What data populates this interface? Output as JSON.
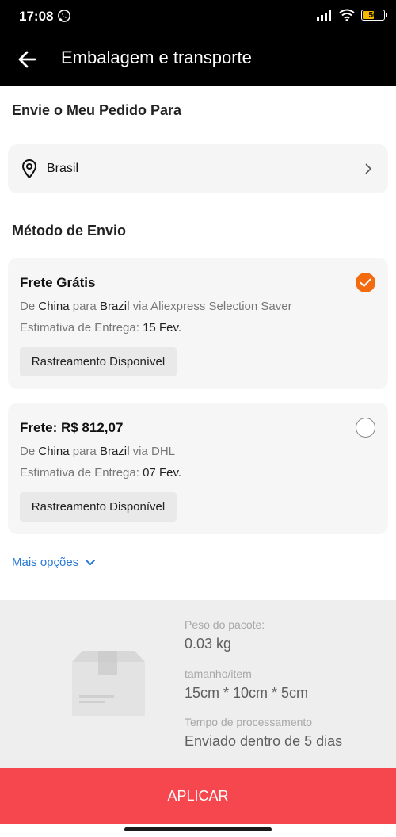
{
  "status_bar": {
    "time": "17:08",
    "battery_level": "50",
    "icons": [
      "whatsapp-icon",
      "signal-icon",
      "wifi-icon",
      "battery-icon"
    ]
  },
  "app_bar": {
    "title": "Embalagem e transporte",
    "back_icon": "arrow-left-icon"
  },
  "destination": {
    "heading": "Envie o Meu Pedido Para",
    "country": "Brasil"
  },
  "shipping": {
    "heading": "Método de Envio",
    "options": [
      {
        "title": "Frete Grátis",
        "from_prefix": "De",
        "origin": "China",
        "to_word": "para",
        "destination": "Brazil",
        "via_word": "via",
        "carrier": "Aliexpress Selection Saver",
        "eta_label": "Estimativa de Entrega:",
        "eta_date": "15 Fev.",
        "tracking": "Rastreamento Disponível",
        "selected": true
      },
      {
        "title": "Frete: R$ 812,07",
        "from_prefix": "De",
        "origin": "China",
        "to_word": "para",
        "destination": "Brazil",
        "via_word": "via",
        "carrier": "DHL",
        "eta_label": "Estimativa de Entrega:",
        "eta_date": "07 Fev.",
        "tracking": "Rastreamento Disponível",
        "selected": false
      }
    ],
    "more_label": "Mais opções"
  },
  "package": {
    "weight_label": "Peso do pacote:",
    "weight_value": "0.03 kg",
    "size_label": "tamanho/item",
    "size_value": "15cm * 10cm * 5cm",
    "processing_label": "Tempo de processamento",
    "processing_value": "Enviado dentro de 5 dias"
  },
  "apply_button": "APLICAR",
  "colors": {
    "accent_orange": "#f46a10",
    "apply_red": "#f6474e",
    "link_blue": "#2879d9"
  }
}
